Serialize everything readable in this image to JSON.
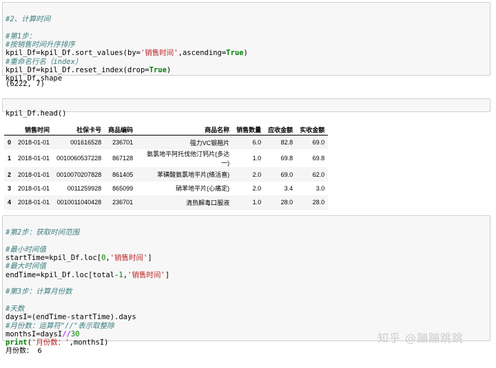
{
  "cell1": {
    "lines": [
      "#2、计算时间",
      "",
      "#第1步：",
      "#按销售时间升序排序",
      "kpil_Df=kpil_Df.sort_values(by='销售时间',ascending=True)",
      "#重命名行名（index）",
      "kpil_Df=kpil_Df.reset_index(drop=True)",
      "kpil_Df.shape"
    ]
  },
  "output1": "(6222, 7)",
  "cell2": {
    "lines": [
      "kpil_Df.head()"
    ]
  },
  "table": {
    "columns": [
      "",
      "销售时间",
      "社保卡号",
      "商品编码",
      "商品名称",
      "销售数量",
      "应收金额",
      "实收金额"
    ],
    "rows": [
      [
        "0",
        "2018-01-01",
        "001616528",
        "236701",
        "强力VC银翘片",
        "6.0",
        "82.8",
        "69.0"
      ],
      [
        "1",
        "2018-01-01",
        "0010060537228",
        "867128",
        "氨氯地平阿托伐他汀钙片(多达一)",
        "1.0",
        "69.8",
        "69.8"
      ],
      [
        "2",
        "2018-01-01",
        "0010070207828",
        "861405",
        "苯磺酸氨氯地平片(络活喜)",
        "2.0",
        "69.0",
        "62.0"
      ],
      [
        "3",
        "2018-01-01",
        "0011259928",
        "865099",
        "硝苯地平片(心痛定)",
        "2.0",
        "3.4",
        "3.0"
      ],
      [
        "4",
        "2018-01-01",
        "0010011040428",
        "236701",
        "清热解毒口服液",
        "1.0",
        "28.0",
        "28.0"
      ]
    ]
  },
  "cell3": {
    "lines": [
      "#第2步：获取时间范围",
      "",
      "#最小时间值",
      "startTime=kpil_Df.loc[0,'销售时间']",
      "#最大时间值",
      "endTime=kpil_Df.loc[total-1,'销售时间']",
      "",
      "#第3步：计算月份数",
      "",
      "#天数",
      "daysI=(endTime-startTime).days",
      "#月份数：运算符\"//\"表示取整除",
      "monthsI=daysI//30",
      "print('月份数：',monthsI)"
    ]
  },
  "output2": "月份数：  6",
  "watermark": "知乎 @蹦蹦跳跳"
}
